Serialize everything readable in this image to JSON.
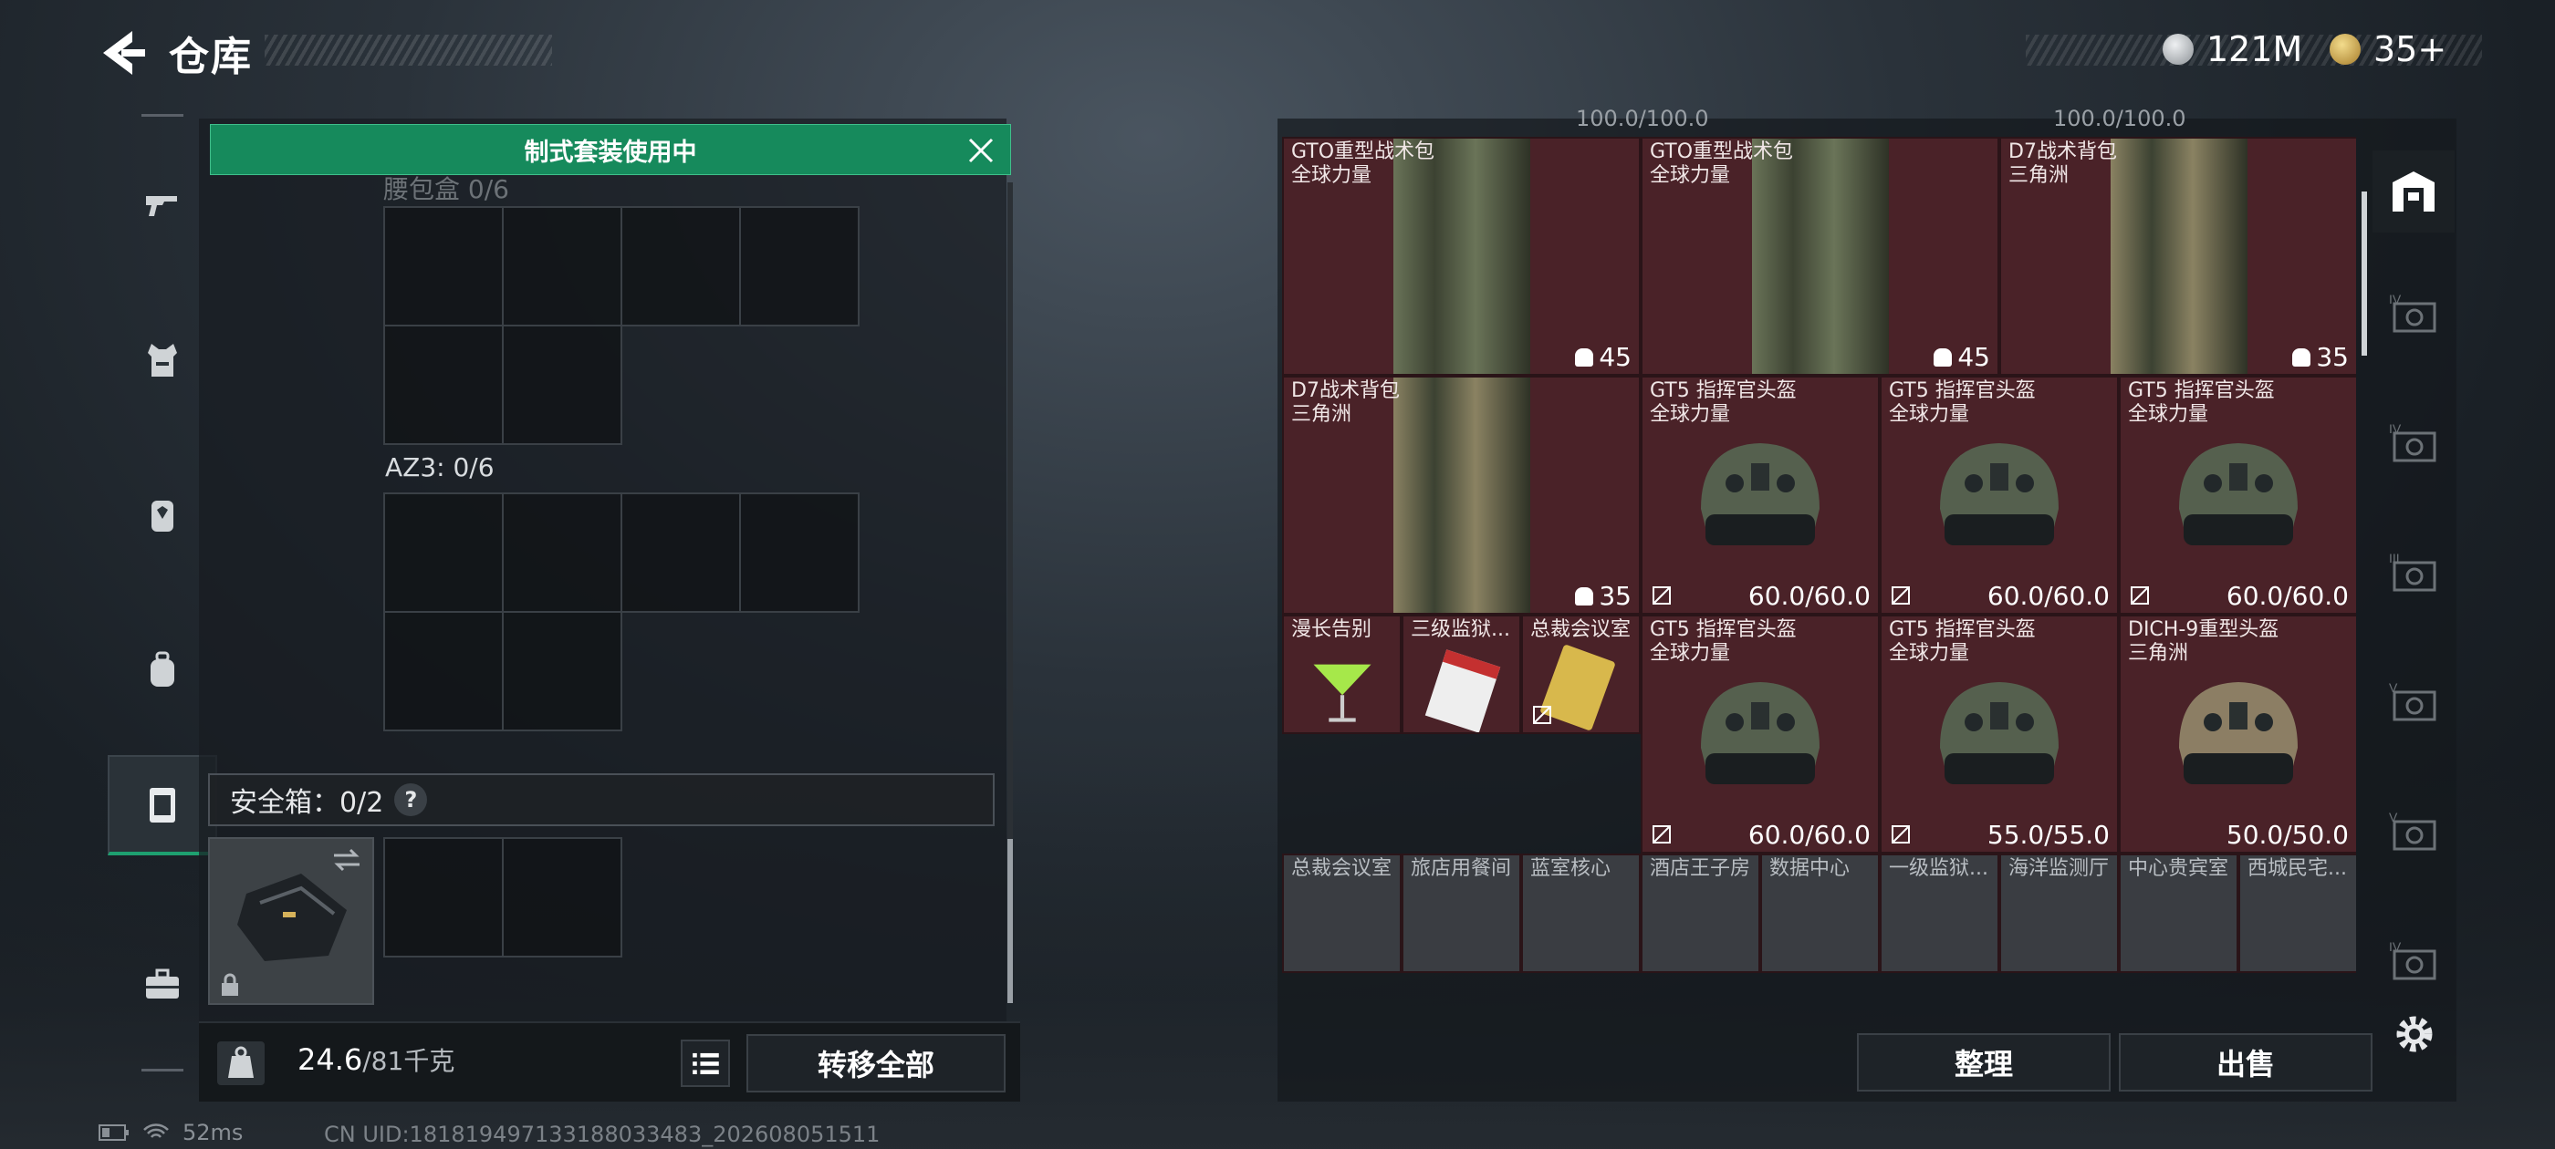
{
  "header": {
    "title": "仓库",
    "coins": [
      {
        "icon": "silver-coin-icon",
        "value": "121M",
        "color": "#c8ccd0"
      },
      {
        "icon": "gold-triangle-coin-icon",
        "value": "35+",
        "color": "#d6b25a"
      }
    ]
  },
  "left_nav": [
    {
      "icon": "gun-icon"
    },
    {
      "icon": "vest-icon"
    },
    {
      "icon": "backpack-armor-icon"
    },
    {
      "icon": "backpack-icon"
    },
    {
      "icon": "container-icon",
      "active": true
    },
    {
      "icon": "toolbox-icon"
    }
  ],
  "banner": {
    "text": "制式套装使用中"
  },
  "slots": {
    "partial_label": "腰包盒 0/6",
    "az3_label": "AZ3: 0/6"
  },
  "safe_box": {
    "label": "安全箱：0/2",
    "help": "?"
  },
  "weight": {
    "current": "24.6",
    "max": "/81千克"
  },
  "buttons": {
    "transfer_all": "转移全部",
    "arrange": "整理",
    "sell": "出售"
  },
  "status": {
    "ping": "52ms",
    "uid": "CN UID:181819497133188033483_202608051511"
  },
  "stash_top_overflow": [
    "100.0/100.0",
    "100.0/100.0"
  ],
  "stash": [
    {
      "name": "GTO重型战术包",
      "sub": "全球力量",
      "value": "45",
      "type": "bag",
      "shade": "#6a7458"
    },
    {
      "name": "GTO重型战术包",
      "sub": "全球力量",
      "value": "45",
      "type": "bag",
      "shade": "#6a7458"
    },
    {
      "name": "D7战术背包",
      "sub": "三角洲",
      "value": "35",
      "type": "bag",
      "shade": "#8a8262"
    },
    {
      "name": "D7战术背包",
      "sub": "三角洲",
      "value": "35",
      "type": "bag",
      "shade": "#8a8262"
    },
    {
      "name": "GT5 指挥官头盔",
      "sub": "全球力量",
      "value": "60.0/60.0",
      "type": "helmet"
    },
    {
      "name": "GT5 指挥官头盔",
      "sub": "全球力量",
      "value": "60.0/60.0",
      "type": "helmet"
    },
    {
      "name": "GT5 指挥官头盔",
      "sub": "全球力量",
      "value": "60.0/60.0",
      "type": "helmet"
    },
    {
      "name": "GT5 指挥官头盔",
      "sub": "全球力量",
      "value": "60.0/60.0",
      "type": "helmet"
    },
    {
      "name": "GT5 指挥官头盔",
      "sub": "全球力量",
      "value": "55.0/55.0",
      "type": "helmet"
    },
    {
      "name": "DICH-9重型头盔",
      "sub": "三角洲",
      "value": "50.0/50.0",
      "type": "helmet2"
    },
    {
      "name": "漫长告别",
      "sub": "",
      "value": "",
      "type": "drink"
    },
    {
      "name": "三级监狱...",
      "sub": "",
      "value": "",
      "type": "card"
    },
    {
      "name": "总裁会议室",
      "sub": "",
      "value": "",
      "type": "key"
    }
  ],
  "stash_bottom_row": [
    "总裁会议室",
    "旅店用餐间",
    "蓝室核心",
    "酒店王子房",
    "数据中心",
    "一级监狱...",
    "海洋监测厅",
    "中心贵宾室",
    "西城民宅..."
  ],
  "right_tabs": [
    {
      "icon": "stash-home-icon",
      "active": true,
      "label": ""
    },
    {
      "icon": "tier-iv-case-icon",
      "label": "IV"
    },
    {
      "icon": "tier-iv-case-icon",
      "label": "IV"
    },
    {
      "icon": "tier-iii-case-icon",
      "label": "III"
    },
    {
      "icon": "tier-v-case-icon",
      "label": "V"
    },
    {
      "icon": "tier-v-case-icon",
      "label": "V"
    },
    {
      "icon": "tier-iv-case-icon",
      "label": "IV"
    }
  ]
}
